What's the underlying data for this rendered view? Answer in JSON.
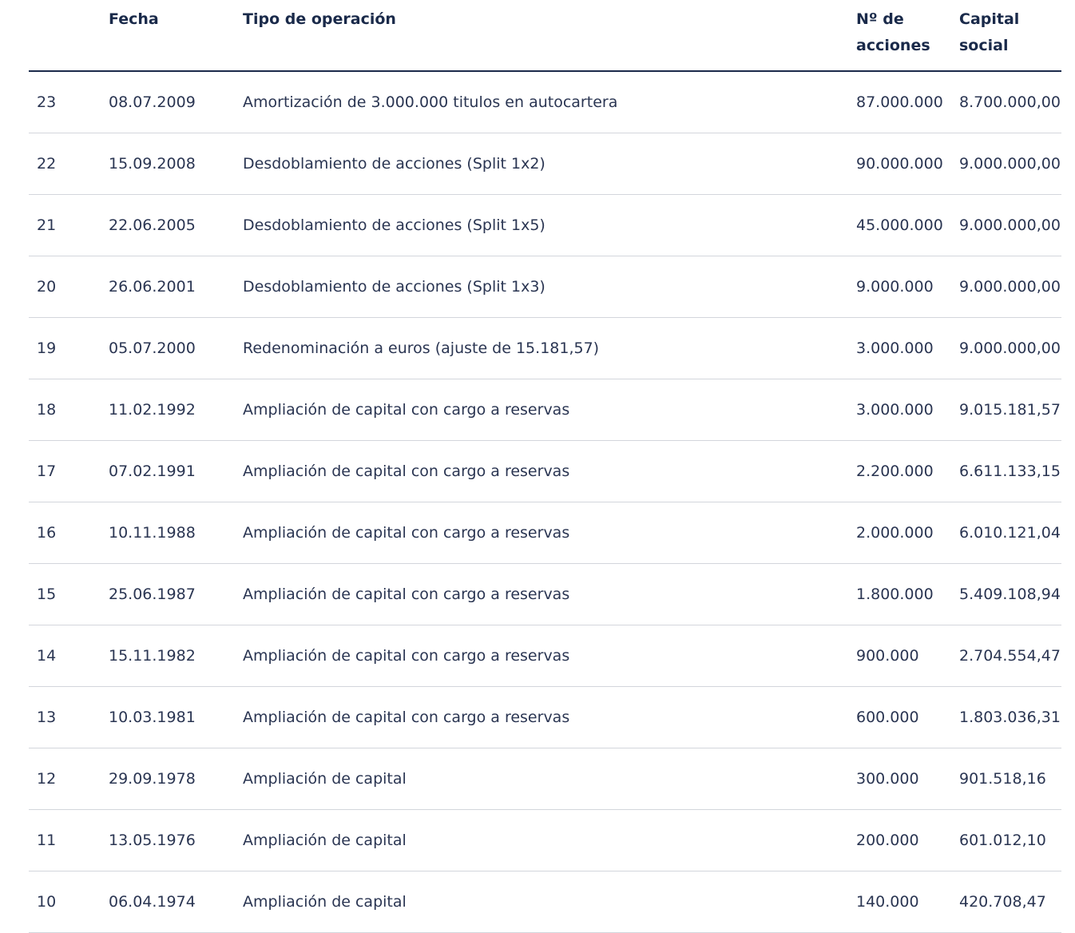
{
  "table": {
    "headers": {
      "number": "",
      "date": "Fecha",
      "operation": "Tipo de operación",
      "shares_line1": "Nº de",
      "shares_line2": "acciones",
      "capital_line1": "Capital",
      "capital_line2": "social"
    },
    "rows": [
      {
        "num": "23",
        "date": "08.07.2009",
        "operation": "Amortización de 3.000.000 titulos en autocartera",
        "shares": "87.000.000",
        "capital": "8.700.000,00"
      },
      {
        "num": "22",
        "date": "15.09.2008",
        "operation": "Desdoblamiento de acciones (Split 1x2)",
        "shares": "90.000.000",
        "capital": "9.000.000,00"
      },
      {
        "num": "21",
        "date": "22.06.2005",
        "operation": "Desdoblamiento de acciones (Split 1x5)",
        "shares": "45.000.000",
        "capital": "9.000.000,00"
      },
      {
        "num": "20",
        "date": "26.06.2001",
        "operation": "Desdoblamiento de acciones (Split 1x3)",
        "shares": "9.000.000",
        "capital": "9.000.000,00"
      },
      {
        "num": "19",
        "date": "05.07.2000",
        "operation": "Redenominación a euros (ajuste de 15.181,57)",
        "shares": "3.000.000",
        "capital": "9.000.000,00"
      },
      {
        "num": "18",
        "date": "11.02.1992",
        "operation": "Ampliación de capital con cargo a reservas",
        "shares": "3.000.000",
        "capital": "9.015.181,57"
      },
      {
        "num": "17",
        "date": "07.02.1991",
        "operation": "Ampliación de capital con cargo a reservas",
        "shares": "2.200.000",
        "capital": "6.611.133,15"
      },
      {
        "num": "16",
        "date": "10.11.1988",
        "operation": "Ampliación de capital con cargo a reservas",
        "shares": "2.000.000",
        "capital": "6.010.121,04"
      },
      {
        "num": "15",
        "date": "25.06.1987",
        "operation": "Ampliación de capital con cargo a reservas",
        "shares": "1.800.000",
        "capital": "5.409.108,94"
      },
      {
        "num": "14",
        "date": "15.11.1982",
        "operation": "Ampliación de capital con cargo a reservas",
        "shares": "900.000",
        "capital": "2.704.554,47"
      },
      {
        "num": "13",
        "date": "10.03.1981",
        "operation": "Ampliación de capital con cargo a reservas",
        "shares": "600.000",
        "capital": "1.803.036,31"
      },
      {
        "num": "12",
        "date": "29.09.1978",
        "operation": "Ampliación de capital",
        "shares": "300.000",
        "capital": "901.518,16"
      },
      {
        "num": "11",
        "date": "13.05.1976",
        "operation": "Ampliación de capital",
        "shares": "200.000",
        "capital": "601.012,10"
      },
      {
        "num": "10",
        "date": "06.04.1974",
        "operation": "Ampliación de capital",
        "shares": "140.000",
        "capital": "420.708,47"
      }
    ]
  },
  "colors": {
    "text": "#1a2a4a",
    "header_rule": "#1b2a4b",
    "row_rule": "#d3d6dc"
  }
}
